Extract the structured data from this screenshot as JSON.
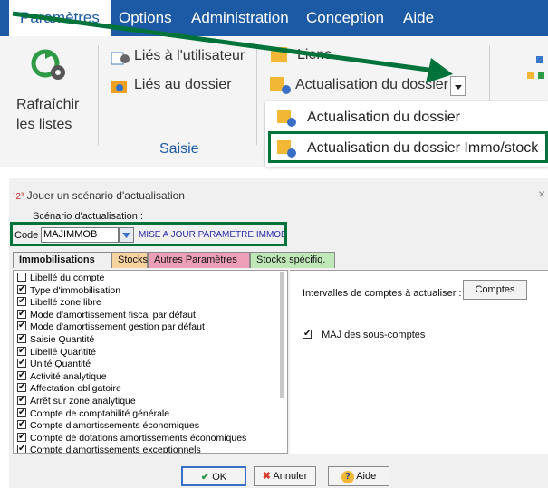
{
  "menubar": {
    "items": [
      "Paramètres",
      "Options",
      "Administration",
      "Conception",
      "Aide"
    ]
  },
  "ribbon": {
    "refresh_label_1": "Rafraîchir",
    "refresh_label_2": "les listes",
    "lies_utilisateur": "Liés à l'utilisateur",
    "lies_dossier": "Liés au dossier",
    "saisie": "Saisie",
    "liens": "Liens",
    "actualisation_dossier": "Actualisation du dossier",
    "popup_items": [
      "Actualisation du dossier",
      "Actualisation du dossier Immo/stock"
    ]
  },
  "dialog": {
    "title": "Jouer un scénario d'actualisation",
    "title_num": "1 2 3",
    "close": "×",
    "scenario_label": "Scénario d'actualisation :",
    "code_label": "Code",
    "code_value": "MAJIMMOB",
    "code_description": "MISE A JOUR PARAMETRE IMMOB",
    "tabs": [
      "Immobilisations",
      "Stocks",
      "Autres Paramètres",
      "Stocks spécifiq."
    ],
    "list": [
      {
        "label": "Libellé du compte",
        "checked": false
      },
      {
        "label": "Type d'immobilisation",
        "checked": true
      },
      {
        "label": "Libellé zone libre",
        "checked": true
      },
      {
        "label": "Mode d'amortissement fiscal par défaut",
        "checked": true
      },
      {
        "label": "Mode d'amortissement gestion par défaut",
        "checked": true
      },
      {
        "label": "Saisie Quantité",
        "checked": true
      },
      {
        "label": "Libellé Quantité",
        "checked": true
      },
      {
        "label": "Unité Quantité",
        "checked": true
      },
      {
        "label": "Activité analytique",
        "checked": true
      },
      {
        "label": "Affectation obligatoire",
        "checked": true
      },
      {
        "label": "Arrêt sur zone analytique",
        "checked": true
      },
      {
        "label": "Compte de comptabilité générale",
        "checked": true
      },
      {
        "label": "Compte d'amortissements économiques",
        "checked": true
      },
      {
        "label": "Compte de dotations amortissements économiques",
        "checked": true
      },
      {
        "label": "Compte d'amortissements exceptionnels",
        "checked": true
      }
    ],
    "intervals_label": "Intervalles de comptes à actualiser :",
    "comptes_button": "Comptes",
    "maj_label": "MAJ des sous-comptes",
    "maj_checked": true,
    "ok": "OK",
    "annuler": "Annuler",
    "aide": "Aide"
  },
  "colors": {
    "menubar": "#1c5aa6",
    "highlight": "#00733a"
  }
}
